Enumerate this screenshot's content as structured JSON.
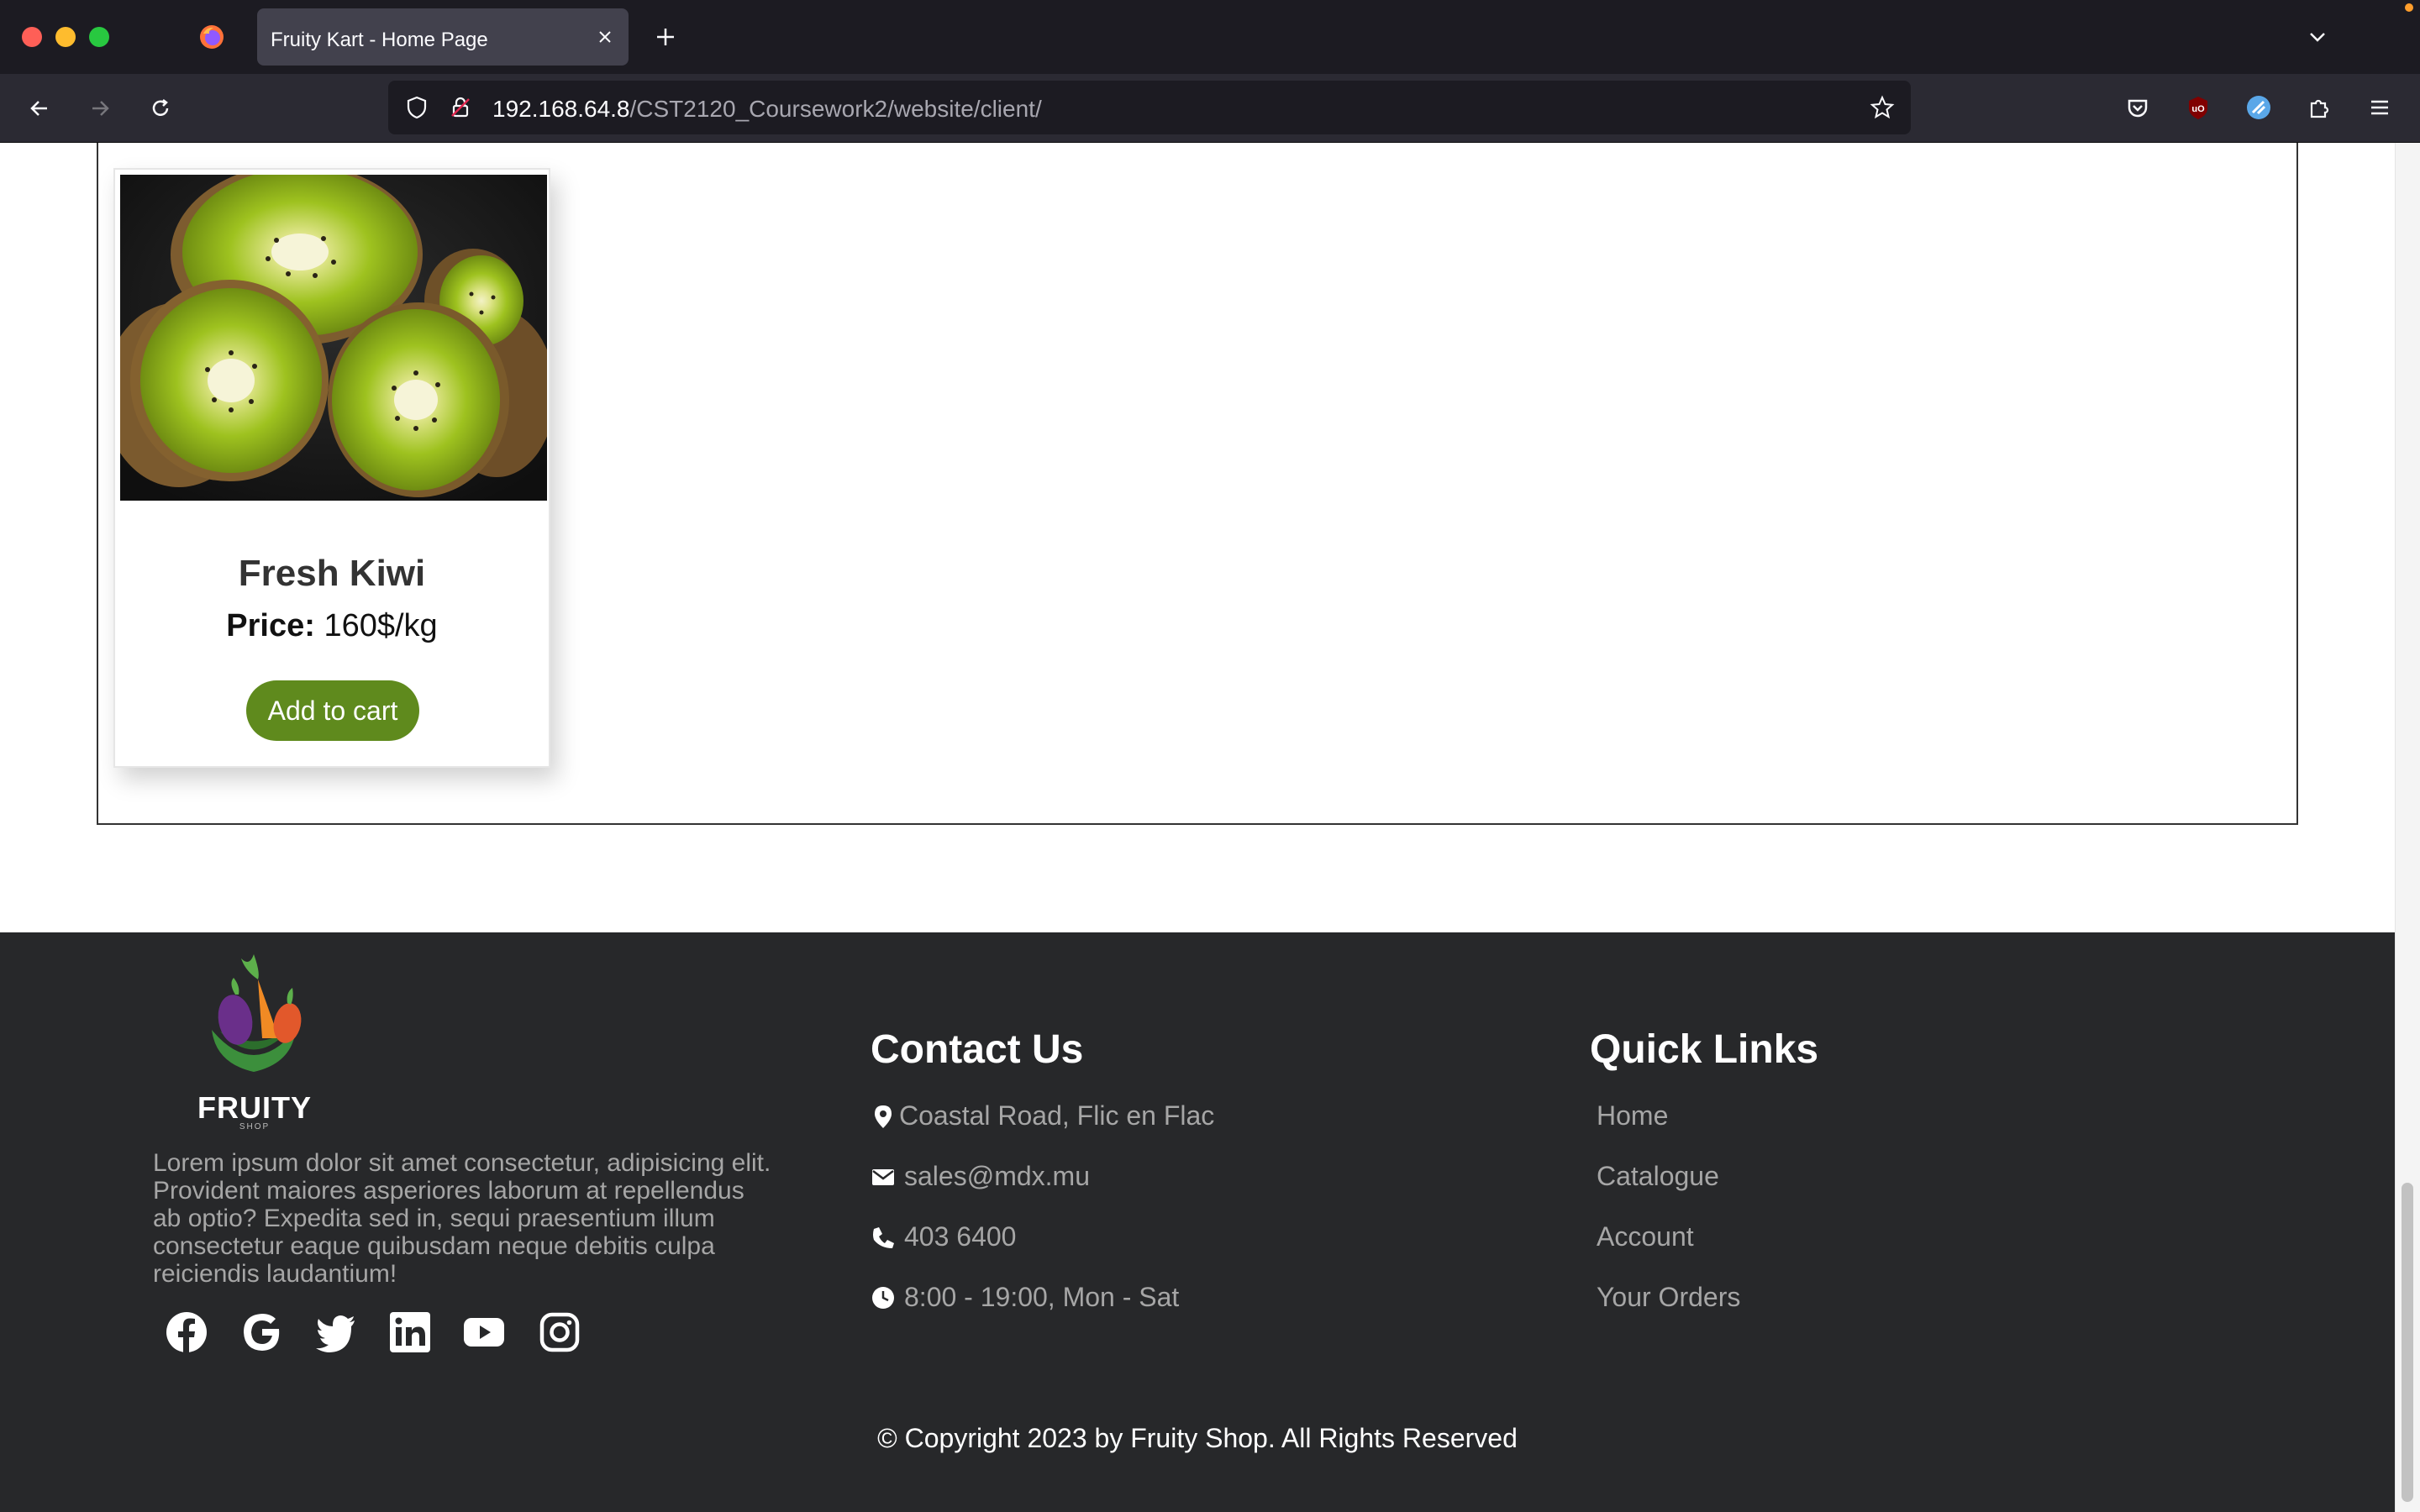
{
  "browser": {
    "tab_title": "Fruity Kart - Home Page",
    "url_host": "192.168.64.8",
    "url_path": "/CST2120_Coursework2/website/client/"
  },
  "product": {
    "name": "Fresh Kiwi",
    "price_label": "Price:",
    "price_value": " 160$/kg",
    "button_label": "Add to cart"
  },
  "footer": {
    "logo_name": "FRUITY",
    "logo_sub": "SHOP",
    "description": "Lorem ipsum dolor sit amet consectetur, adipisicing elit. Provident maiores asperiores laborum at repellendus ab optio? Expedita sed in, sequi praesentium illum consectetur eaque quibusdam neque debitis culpa reiciendis laudantium!",
    "social_icons": [
      "facebook-icon",
      "google-icon",
      "twitter-icon",
      "linkedin-icon",
      "youtube-icon",
      "instagram-icon"
    ],
    "contact": {
      "title": "Contact Us",
      "address": "Coastal Road, Flic en Flac",
      "email": "sales@mdx.mu",
      "phone": "403 6400",
      "hours": "8:00 - 19:00, Mon - Sat"
    },
    "quick_links": {
      "title": "Quick Links",
      "items": [
        "Home",
        "Catalogue",
        "Account",
        "Your Orders"
      ]
    },
    "copyright": "© Copyright 2023 by Fruity Shop. All Rights Reserved"
  },
  "colors": {
    "accent_green": "#5f8a1d",
    "footer_bg": "#27282a",
    "chrome_bg": "#1c1b22"
  }
}
